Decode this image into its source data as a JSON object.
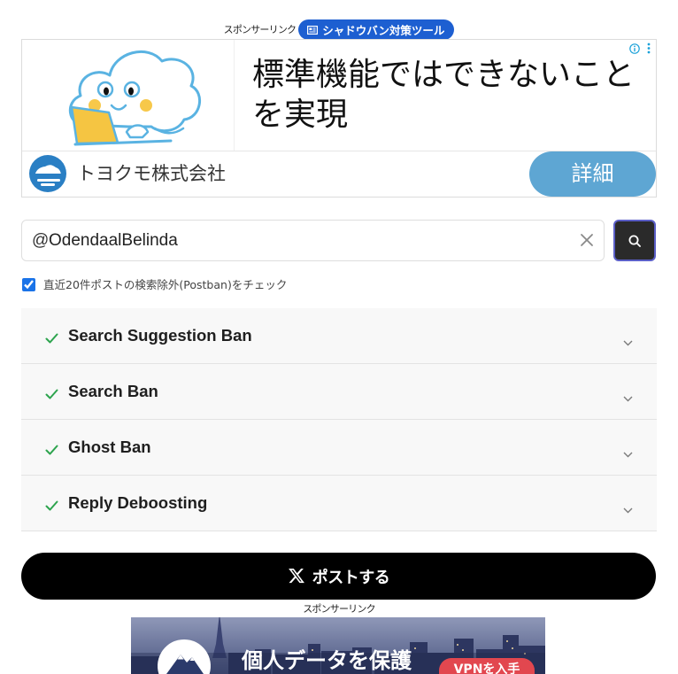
{
  "sponsor_top": {
    "label": "スポンサーリンク",
    "pill_label": "シャドウバン対策ツール",
    "pill_icon": "newspaper-icon"
  },
  "ad": {
    "headline_lines": [
      "標準機能ではできないこと",
      "を実現"
    ],
    "advertiser": "トヨクモ株式会社",
    "cta": "詳細",
    "icons": {
      "info": "info-icon",
      "menu": "kebab-menu-icon",
      "logo": "advertiser-logo"
    }
  },
  "search": {
    "prefix": "@",
    "value": "OdendaalBelinda",
    "clear_icon": "close-icon",
    "button_icon": "search-icon"
  },
  "postban": {
    "checked": true,
    "label": "直近20件ポストの検索除外(Postban)をチェック"
  },
  "results": [
    {
      "label": "Search Suggestion Ban",
      "status_icon": "check-icon",
      "expanded": false
    },
    {
      "label": "Search Ban",
      "status_icon": "check-icon",
      "expanded": false
    },
    {
      "label": "Ghost Ban",
      "status_icon": "check-icon",
      "expanded": false
    },
    {
      "label": "Reply Deboosting",
      "status_icon": "check-icon",
      "expanded": false
    }
  ],
  "post_button": {
    "label": "ポストする",
    "icon": "x-logo-icon"
  },
  "sponsor_bottom": {
    "label": "スポンサーリンク",
    "headline": "個人データを保護",
    "cta": "VPNを入手"
  },
  "colors": {
    "pill_blue": "#1d5fd1",
    "ad_cta_blue": "#5ea6d3",
    "check_green": "#2da44e",
    "checkbox_blue": "#1a73e8",
    "search_button_bg": "#2a2a2a",
    "search_button_ring": "#5b5fc7",
    "post_button_bg": "#000000",
    "row_bg": "#f8f8f8",
    "vpn_cta_red": "#e2474f"
  }
}
